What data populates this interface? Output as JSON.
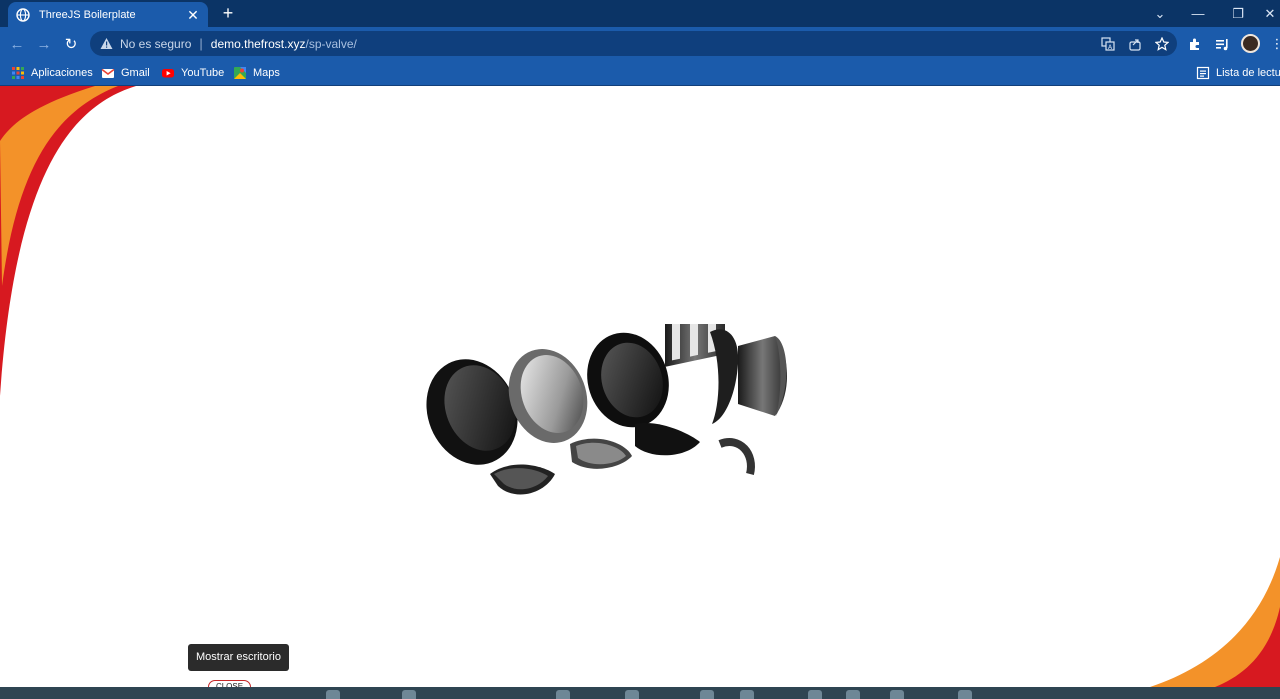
{
  "browser": {
    "tab": {
      "title": "ThreeJS Boilerplate",
      "close_glyph": "✕",
      "icon": "globe-icon"
    },
    "new_tab_glyph": "+",
    "window_controls": {
      "dropdown": "⌄",
      "minimize": "—",
      "restore": "❐",
      "close": "✕"
    },
    "nav": {
      "back": "←",
      "forward": "→",
      "reload": "↻"
    },
    "address": {
      "security_label": "No es seguro",
      "separator": "|",
      "host": "demo.thefrost.xyz",
      "path": "/sp-valve/"
    },
    "omnibox_icons": [
      "translate-icon",
      "share-icon",
      "star-icon"
    ],
    "toolbar_icons": [
      "extensions-icon",
      "reading-queue-icon",
      "profile-avatar",
      "menu-icon"
    ],
    "menu_glyph": "⋮",
    "bookmarks": [
      {
        "label": "Aplicaciones",
        "icon": "apps-grid-icon"
      },
      {
        "label": "Gmail",
        "icon": "gmail-icon"
      },
      {
        "label": "YouTube",
        "icon": "youtube-icon"
      },
      {
        "label": "Maps",
        "icon": "maps-icon"
      }
    ],
    "reading_list_label": "Lista de lectura"
  },
  "page": {
    "brand_colors": {
      "red": "#d71920",
      "orange": "#f39229"
    },
    "tooltip": "Mostrar escritorio",
    "close_chip": "CLOSE"
  }
}
